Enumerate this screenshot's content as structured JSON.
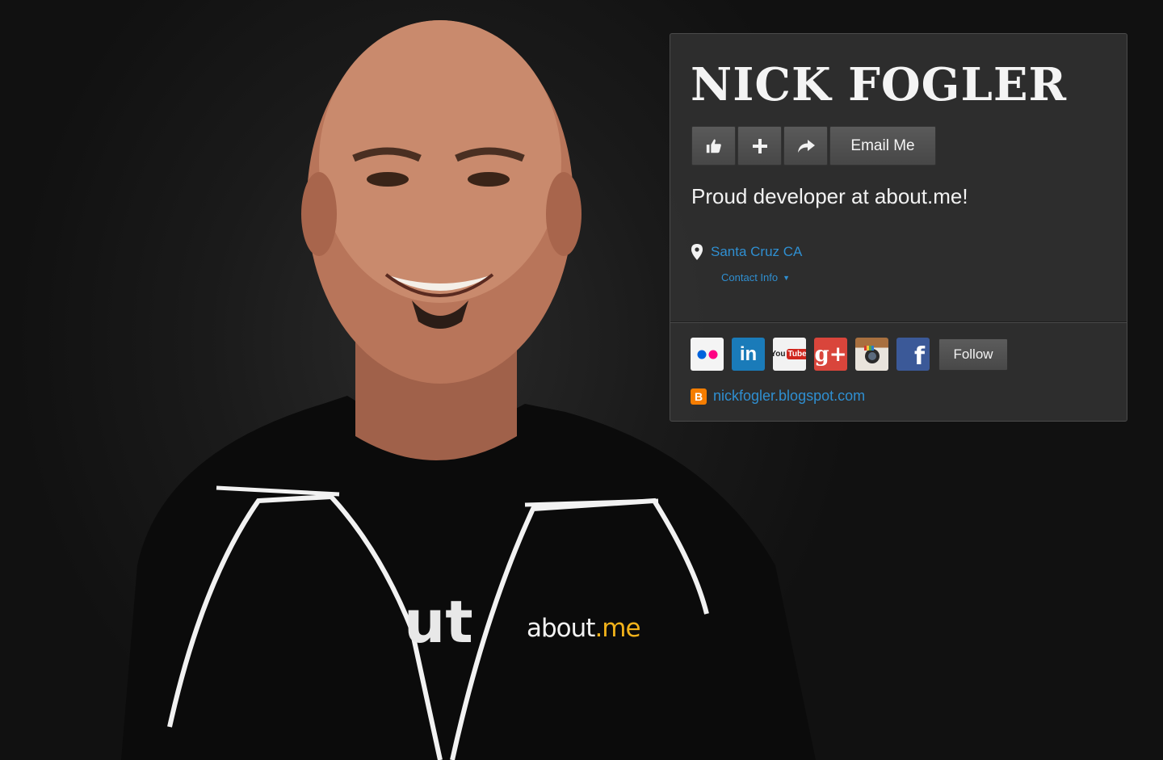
{
  "profile": {
    "name": "NICK FOGLER",
    "headline": "Proud developer at about.me!",
    "location": "Santa Cruz CA",
    "contact_label": "Contact Info",
    "email_label": "Email Me",
    "follow_label": "Follow",
    "blog_link": "nickfogler.blogspot.com"
  },
  "actions": [
    {
      "icon": "thumbs-up-icon"
    },
    {
      "icon": "plus-icon"
    },
    {
      "icon": "share-arrow-icon"
    }
  ],
  "socials": [
    {
      "icon": "flickr-icon"
    },
    {
      "icon": "linkedin-icon",
      "text": "in"
    },
    {
      "icon": "youtube-icon",
      "text_a": "You",
      "text_b": "Tube"
    },
    {
      "icon": "google-plus-icon",
      "text": "g+"
    },
    {
      "icon": "instagram-icon"
    },
    {
      "icon": "facebook-icon",
      "text": "f"
    }
  ],
  "photo": {
    "shirt_text": "about",
    "shirt_text_accent": ".me",
    "shirt_partial": "ut"
  },
  "colors": {
    "link": "#2f8fd1",
    "card_bg": "#303030",
    "blog_orange": "#f57d00",
    "about_me_yellow": "#f1b21a"
  }
}
